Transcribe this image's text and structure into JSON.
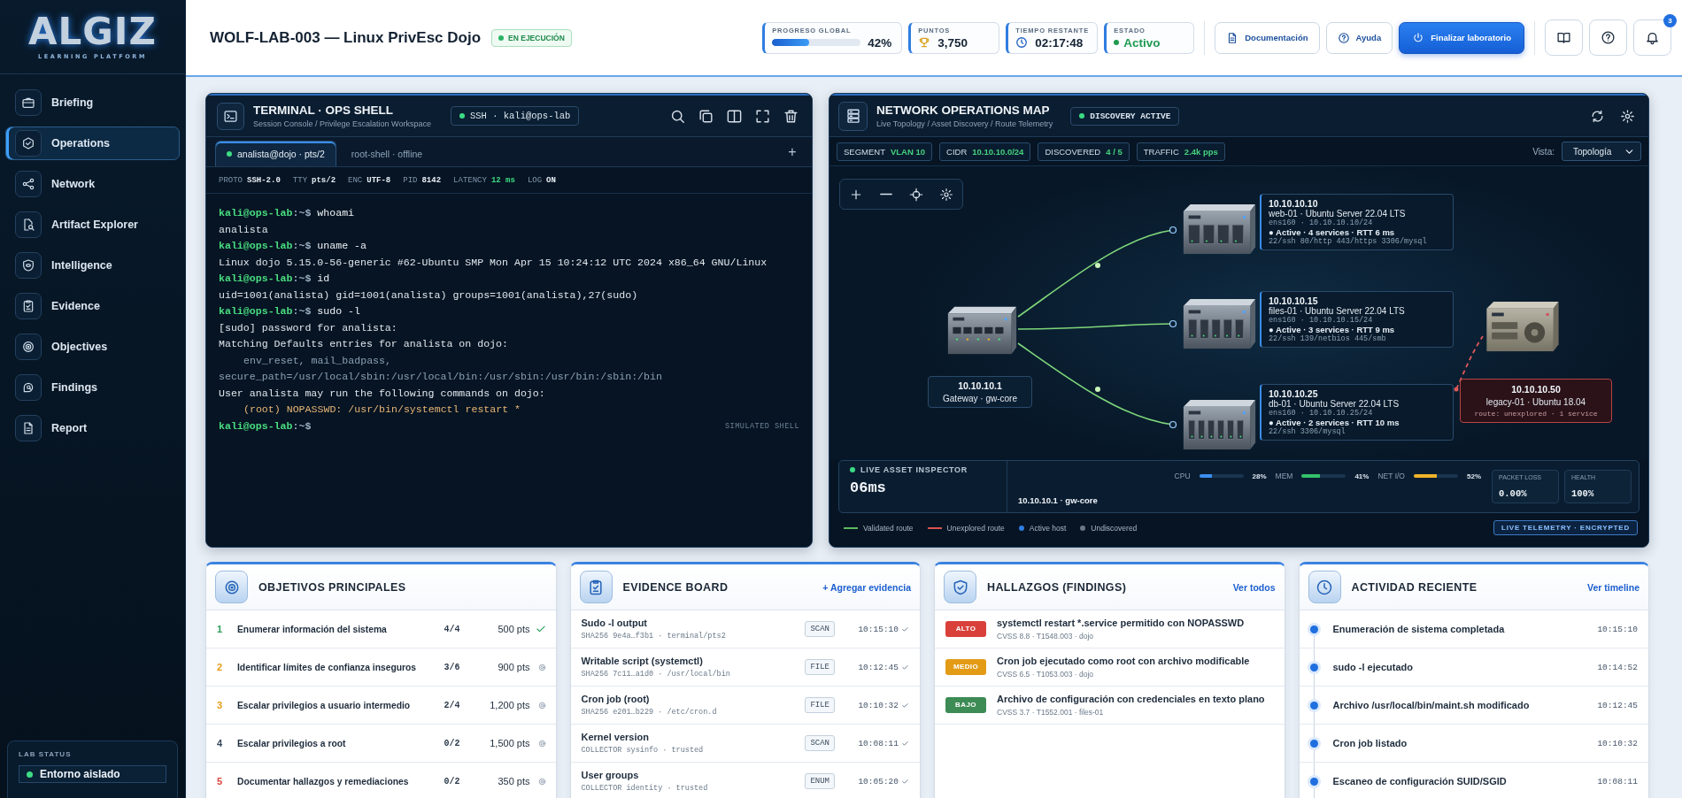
{
  "sidebar": {
    "logo": {
      "title": "ALGIZ",
      "subtitle": "LEARNING PLATFORM"
    },
    "items": [
      {
        "label": "Briefing",
        "selected": false
      },
      {
        "label": "Operations",
        "selected": true
      },
      {
        "label": "Network",
        "selected": false
      },
      {
        "label": "Artifact Explorer",
        "selected": false
      },
      {
        "label": "Intelligence",
        "selected": false
      },
      {
        "label": "Evidence",
        "selected": false
      },
      {
        "label": "Objectives",
        "selected": false
      },
      {
        "label": "Findings",
        "selected": false
      },
      {
        "label": "Report",
        "selected": false
      }
    ],
    "lab_status": {
      "title": "LAB STATUS",
      "value": "Entorno aislado"
    }
  },
  "header": {
    "title": "WOLF-LAB-003 — Linux PrivEsc Dojo",
    "status_badge": "EN EJECUCIÓN",
    "progress": {
      "label": "PROGRESO GLOBAL",
      "level": 0.42,
      "value": "42%"
    },
    "points": {
      "label": "PUNTOS",
      "value": "3,750"
    },
    "time": {
      "label": "TIEMPO RESTANTE",
      "value": "02:17:48"
    },
    "state": {
      "label": "ESTADO",
      "value": "Activo"
    },
    "buttons": [
      {
        "label": "Documentación",
        "kind": "secondary"
      },
      {
        "label": "Ayuda",
        "kind": "secondary"
      },
      {
        "label": "Finalizar laboratorio",
        "kind": "primary"
      }
    ],
    "notifications": "3"
  },
  "terminal": {
    "title": "TERMINAL · OPS SHELL",
    "subtitle": "Session Console / Privilege Escalation Workspace",
    "connection": "SSH · kali@ops-lab",
    "tabs": [
      {
        "label": "analista@dojo · pts/2",
        "selected": true
      },
      {
        "label": "root-shell · offline",
        "selected": false
      }
    ],
    "add_tab": "+",
    "session_info": [
      {
        "key": "PROTO",
        "value": "SSH-2.0"
      },
      {
        "key": "TTY",
        "value": "pts/2"
      },
      {
        "key": "ENC",
        "value": "UTF-8"
      },
      {
        "key": "PID",
        "value": "8142"
      },
      {
        "key": "LATENCY",
        "value": "12 ms",
        "accent": true
      },
      {
        "key": "LOG",
        "value": "ON"
      }
    ],
    "lines": [
      {
        "kind": "prompt",
        "prompt": "kali@ops-lab",
        "path": ":~$",
        "command": "whoami"
      },
      {
        "kind": "output",
        "text": "analista"
      },
      {
        "kind": "prompt",
        "prompt": "kali@ops-lab",
        "path": ":~$",
        "command": "uname -a"
      },
      {
        "kind": "output",
        "text": "Linux dojo 5.15.0-56-generic #62-Ubuntu SMP Mon Apr 15 10:24:12 UTC 2024 x86_64 GNU/Linux"
      },
      {
        "kind": "prompt",
        "prompt": "kali@ops-lab",
        "path": ":~$",
        "command": "id"
      },
      {
        "kind": "output",
        "text": "uid=1001(analista) gid=1001(analista) groups=1001(analista),27(sudo)"
      },
      {
        "kind": "prompt",
        "prompt": "kali@ops-lab",
        "path": ":~$",
        "command": "sudo -l"
      },
      {
        "kind": "output",
        "text": "[sudo] password for analista:"
      },
      {
        "kind": "output",
        "text": "Matching Defaults entries for analista on dojo:"
      },
      {
        "kind": "muted",
        "text": "env_reset, mail_badpass,",
        "indent": true
      },
      {
        "kind": "muted",
        "text": "secure_path=/usr/local/sbin:/usr/local/bin:/usr/sbin:/usr/bin:/sbin:/bin"
      },
      {
        "kind": "output",
        "text": "User analista may run the following commands on dojo:"
      },
      {
        "kind": "highlight",
        "text": "(root) NOPASSWD: /usr/bin/systemctl restart *",
        "indent": true
      },
      {
        "kind": "prompt",
        "prompt": "kali@ops-lab",
        "path": ":~$"
      }
    ],
    "footer_label": "SIMULATED SHELL"
  },
  "network_map": {
    "title": "NETWORK OPERATIONS MAP",
    "subtitle": "Live Topology / Asset Discovery / Route Telemetry",
    "status_chip": "DISCOVERY ACTIVE",
    "chips": [
      {
        "key": "SEGMENT",
        "value": "VLAN 10"
      },
      {
        "key": "CIDR",
        "value": "10.10.10.0/24"
      },
      {
        "key": "DISCOVERED",
        "value": "4 / 5"
      },
      {
        "key": "TRAFFIC",
        "value": "2.4k pps"
      }
    ],
    "view_label": "Vista:",
    "view_value": "Topología",
    "gateway": {
      "ip": "10.10.10.1",
      "label": "Gateway · gw-core"
    },
    "hosts": [
      {
        "kind": "validated",
        "ip": "10.10.10.10",
        "name": "web-01 · Ubuntu Server 22.04 LTS",
        "iface": "ens160 · 10.10.10.10/24",
        "status": "● Active · 4 services · RTT 6 ms",
        "ports": "22/ssh 80/http 443/https 3306/mysql"
      },
      {
        "kind": "validated",
        "ip": "10.10.10.15",
        "name": "files-01 · Ubuntu Server 22.04 LTS",
        "iface": "ens160 · 10.10.10.15/24",
        "status": "● Active · 3 services · RTT 9 ms",
        "ports": "22/ssh 139/netbios 445/smb"
      },
      {
        "kind": "validated",
        "ip": "10.10.10.25",
        "name": "db-01 · Ubuntu Server 22.04 LTS",
        "iface": "ens160 · 10.10.10.25/24",
        "status": "● Active · 2 services · RTT 10 ms",
        "ports": "22/ssh 3306/mysql"
      },
      {
        "kind": "unexplored",
        "ip": "10.10.10.50",
        "name": "legacy-01 · Ubuntu 18.04",
        "note": "route: unexplored · 1 service"
      }
    ],
    "inspector": {
      "title": "LIVE ASSET INSPECTOR",
      "latency": "06ms",
      "host": "10.10.10.1 · gw-core",
      "metrics": [
        {
          "label": "CPU",
          "value": "28%",
          "level": 0.28,
          "color": "#3b8ff0"
        },
        {
          "label": "MEM",
          "value": "41%",
          "level": 0.41,
          "color": "#34c26a"
        },
        {
          "label": "NET I/O",
          "value": "52%",
          "level": 0.52,
          "color": "#f0b429"
        }
      ],
      "stats": [
        {
          "label": "PACKET LOSS",
          "value": "0.00%"
        },
        {
          "label": "HEALTH",
          "value": "100%"
        }
      ]
    },
    "legend": [
      {
        "kind": "line",
        "color": "#5cb85c",
        "label": "Validated route"
      },
      {
        "kind": "line",
        "color": "#d9534f",
        "label": "Unexplored route"
      },
      {
        "kind": "dot",
        "color": "#2f7de1",
        "label": "Active host"
      },
      {
        "kind": "dot",
        "color": "#6b7785",
        "label": "Undiscovered"
      }
    ],
    "telemetry_badge": "LIVE TELEMETRY · ENCRYPTED"
  },
  "objectives": {
    "title": "OBJETIVOS PRINCIPALES",
    "items": [
      {
        "number": "1",
        "color": "#2e9e5b",
        "title": "Enumerar información del sistema",
        "progress": "4/4",
        "points": "500 pts",
        "completed": true
      },
      {
        "number": "2",
        "color": "#e39b16",
        "title": "Identificar límites de confianza inseguros",
        "progress": "3/6",
        "points": "900 pts",
        "completed": false
      },
      {
        "number": "3",
        "color": "#e39b16",
        "title": "Escalar privilegios a usuario intermedio",
        "progress": "2/4",
        "points": "1,200 pts",
        "completed": false
      },
      {
        "number": "4",
        "color": "#34475c",
        "title": "Escalar privilegios a root",
        "progress": "0/2",
        "points": "1,500 pts",
        "completed": false
      },
      {
        "number": "5",
        "color": "#d9443b",
        "title": "Documentar hallazgos y remediaciones",
        "progress": "0/2",
        "points": "350 pts",
        "completed": false
      }
    ]
  },
  "evidence": {
    "title": "EVIDENCE BOARD",
    "action": "+ Agregar evidencia",
    "items": [
      {
        "title": "Sudo -l output",
        "meta": "SHA256 9e4a…f3b1 · terminal/pts2",
        "tag": "SCAN",
        "time": "10:15:10",
        "verified": true
      },
      {
        "title": "Writable script (systemctl)",
        "meta": "SHA256 7c11…a1d0 · /usr/local/bin",
        "tag": "FILE",
        "time": "10:12:45",
        "verified": true
      },
      {
        "title": "Cron job (root)",
        "meta": "SHA256 e201…b229 · /etc/cron.d",
        "tag": "FILE",
        "time": "10:10:32",
        "verified": true
      },
      {
        "title": "Kernel version",
        "meta": "COLLECTOR sysinfo · trusted",
        "tag": "SCAN",
        "time": "10:08:11",
        "verified": true
      },
      {
        "title": "User groups",
        "meta": "COLLECTOR identity · trusted",
        "tag": "ENUM",
        "time": "10:05:20",
        "verified": true
      }
    ]
  },
  "findings": {
    "title": "HALLAZGOS (FINDINGS)",
    "action": "Ver todos",
    "items": [
      {
        "severity": "ALTO",
        "kind": "high",
        "title": "systemctl restart *.service permitido con NOPASSWD",
        "meta": "CVSS 8.8 · T1548.003 · dojo"
      },
      {
        "severity": "MEDIO",
        "kind": "medium",
        "title": "Cron job ejecutado como root con archivo modificable",
        "meta": "CVSS 6.5 · T1053.003 · dojo"
      },
      {
        "severity": "BAJO",
        "kind": "low",
        "title": "Archivo de configuración con credenciales en texto plano",
        "meta": "CVSS 3.7 · T1552.001 · files-01"
      }
    ]
  },
  "activity": {
    "title": "ACTIVIDAD RECIENTE",
    "action": "Ver timeline",
    "items": [
      {
        "text": "Enumeración de sistema completada",
        "time": "10:15:10"
      },
      {
        "text": "sudo -l ejecutado",
        "time": "10:14:52"
      },
      {
        "text": "Archivo /usr/local/bin/maint.sh modificado",
        "time": "10:12:45"
      },
      {
        "text": "Cron job listado",
        "time": "10:10:32"
      },
      {
        "text": "Escaneo de configuración SUID/SGID",
        "time": "10:08:11"
      }
    ]
  }
}
